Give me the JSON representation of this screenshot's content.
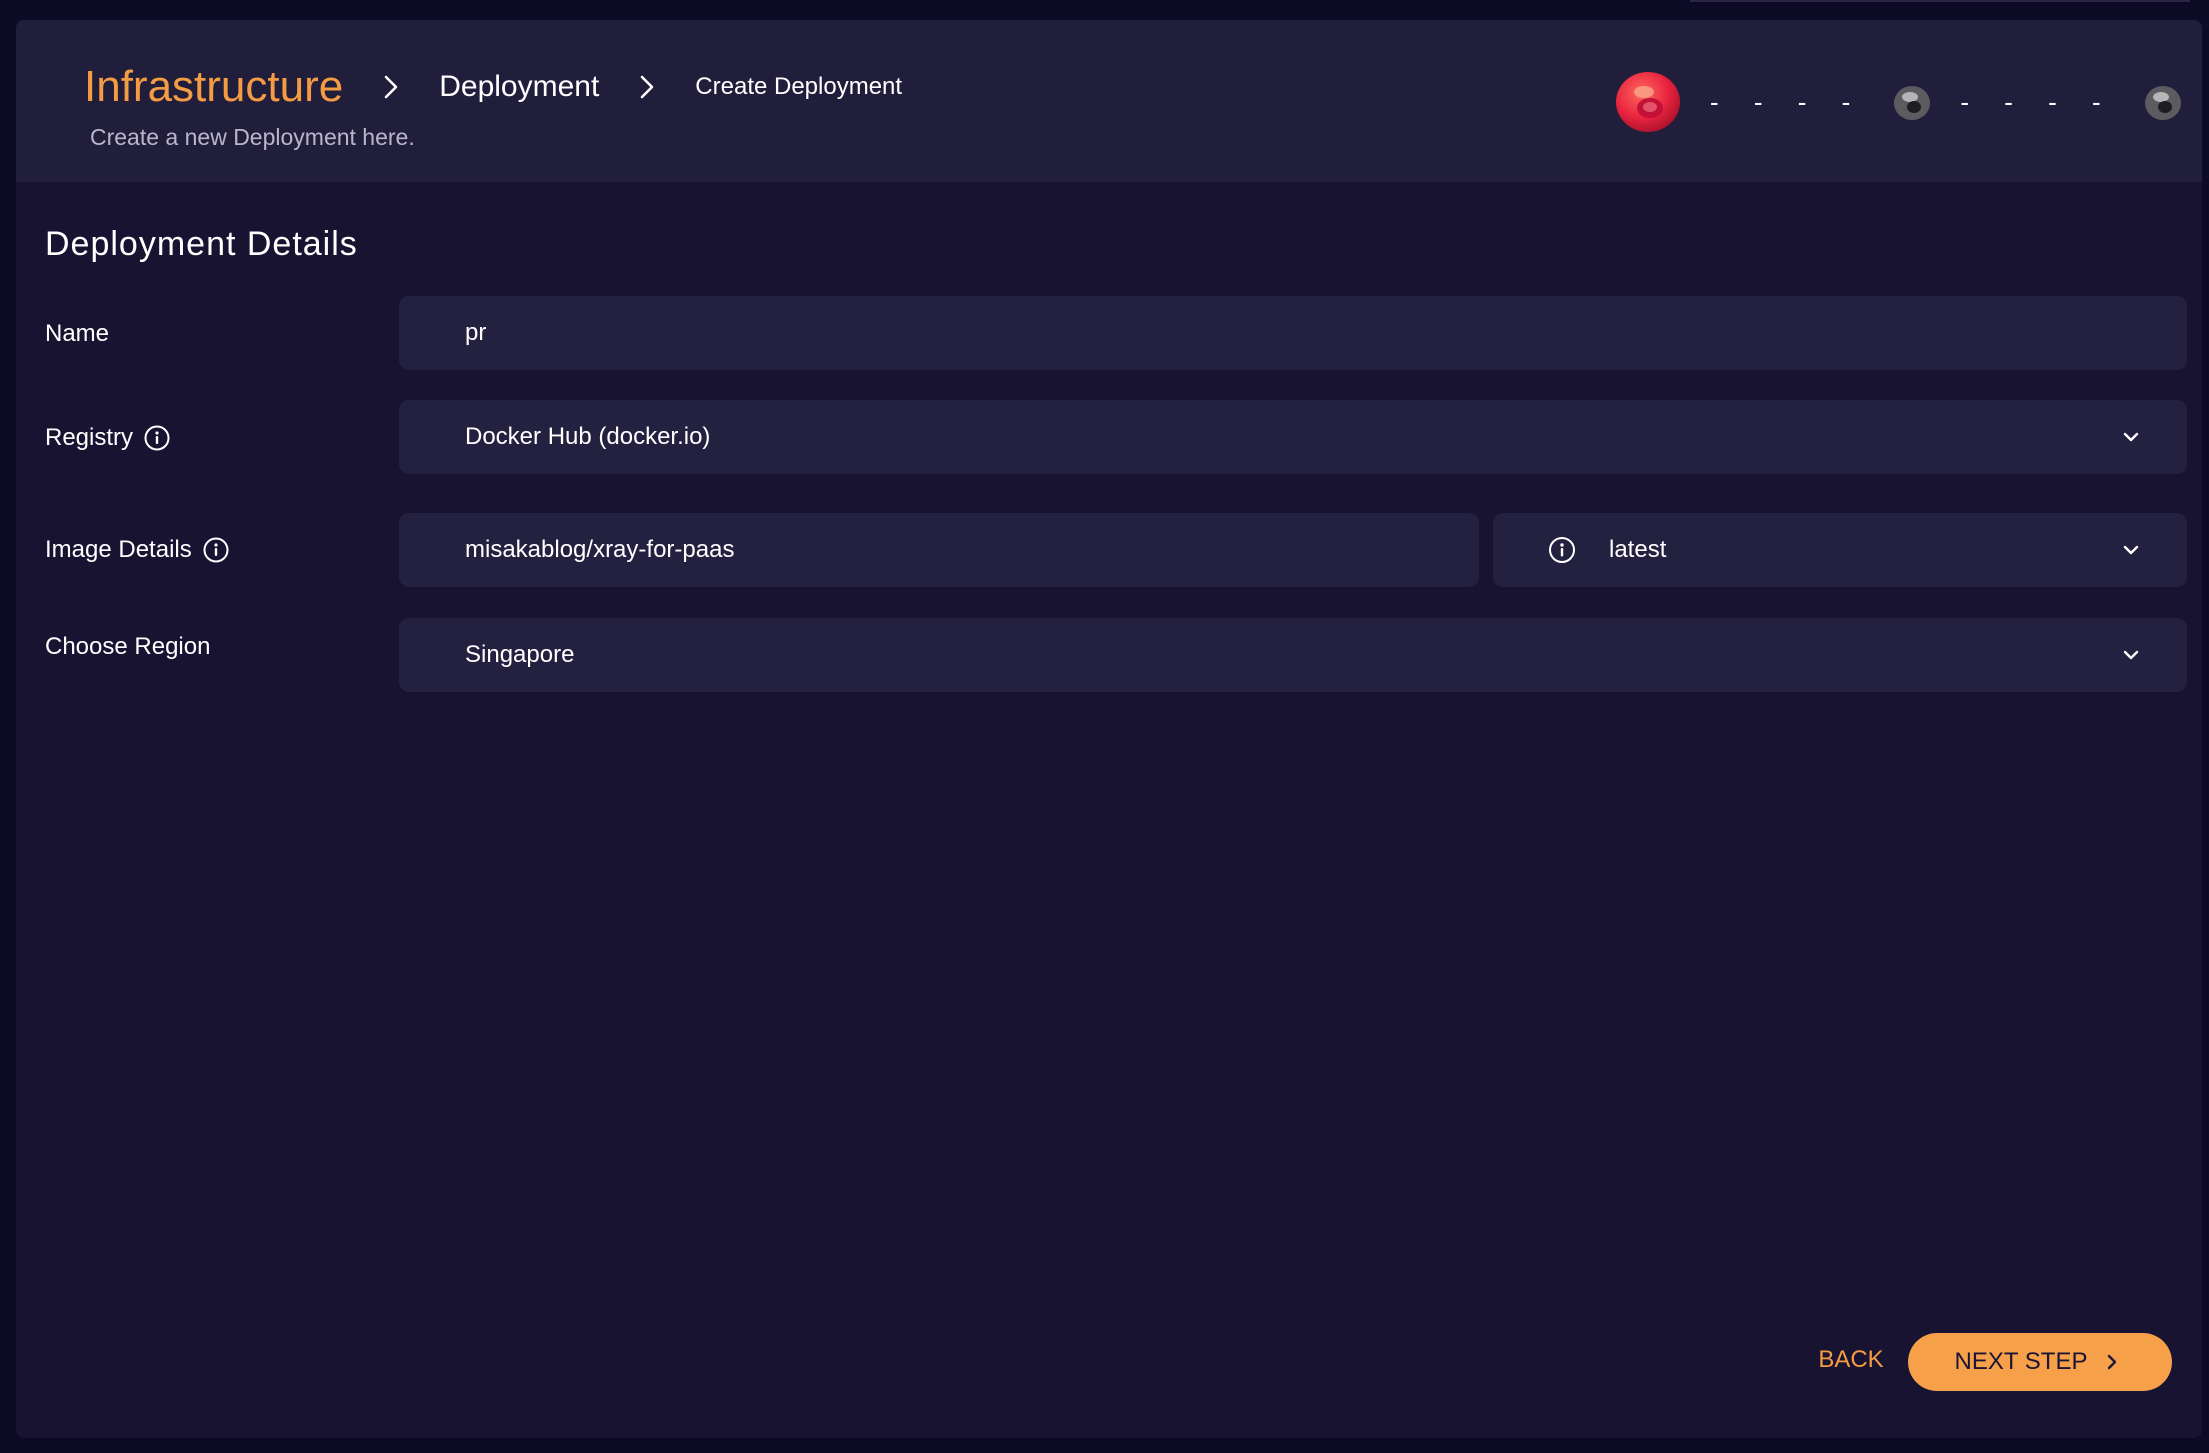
{
  "header": {
    "breadcrumb": [
      "Infrastructure",
      "Deployment",
      "Create Deployment"
    ],
    "subtitle": "Create a new Deployment here.",
    "steps": {
      "dash": "- - - -",
      "count": 3,
      "active_step": 1
    }
  },
  "form": {
    "section_title": "Deployment Details",
    "name": {
      "label": "Name",
      "value": "pr"
    },
    "registry": {
      "label": "Registry",
      "value": "Docker Hub (docker.io)"
    },
    "image": {
      "label": "Image Details",
      "value": "misakablog/xray-for-paas",
      "tag": "latest"
    },
    "region": {
      "label": "Choose Region",
      "value": "Singapore"
    }
  },
  "actions": {
    "back": "BACK",
    "next": "NEXT STEP"
  },
  "colors": {
    "accent": "#f49c43",
    "button": "#f7a04a",
    "panel": "#181331",
    "header": "#211e3c",
    "field": "#242140"
  }
}
